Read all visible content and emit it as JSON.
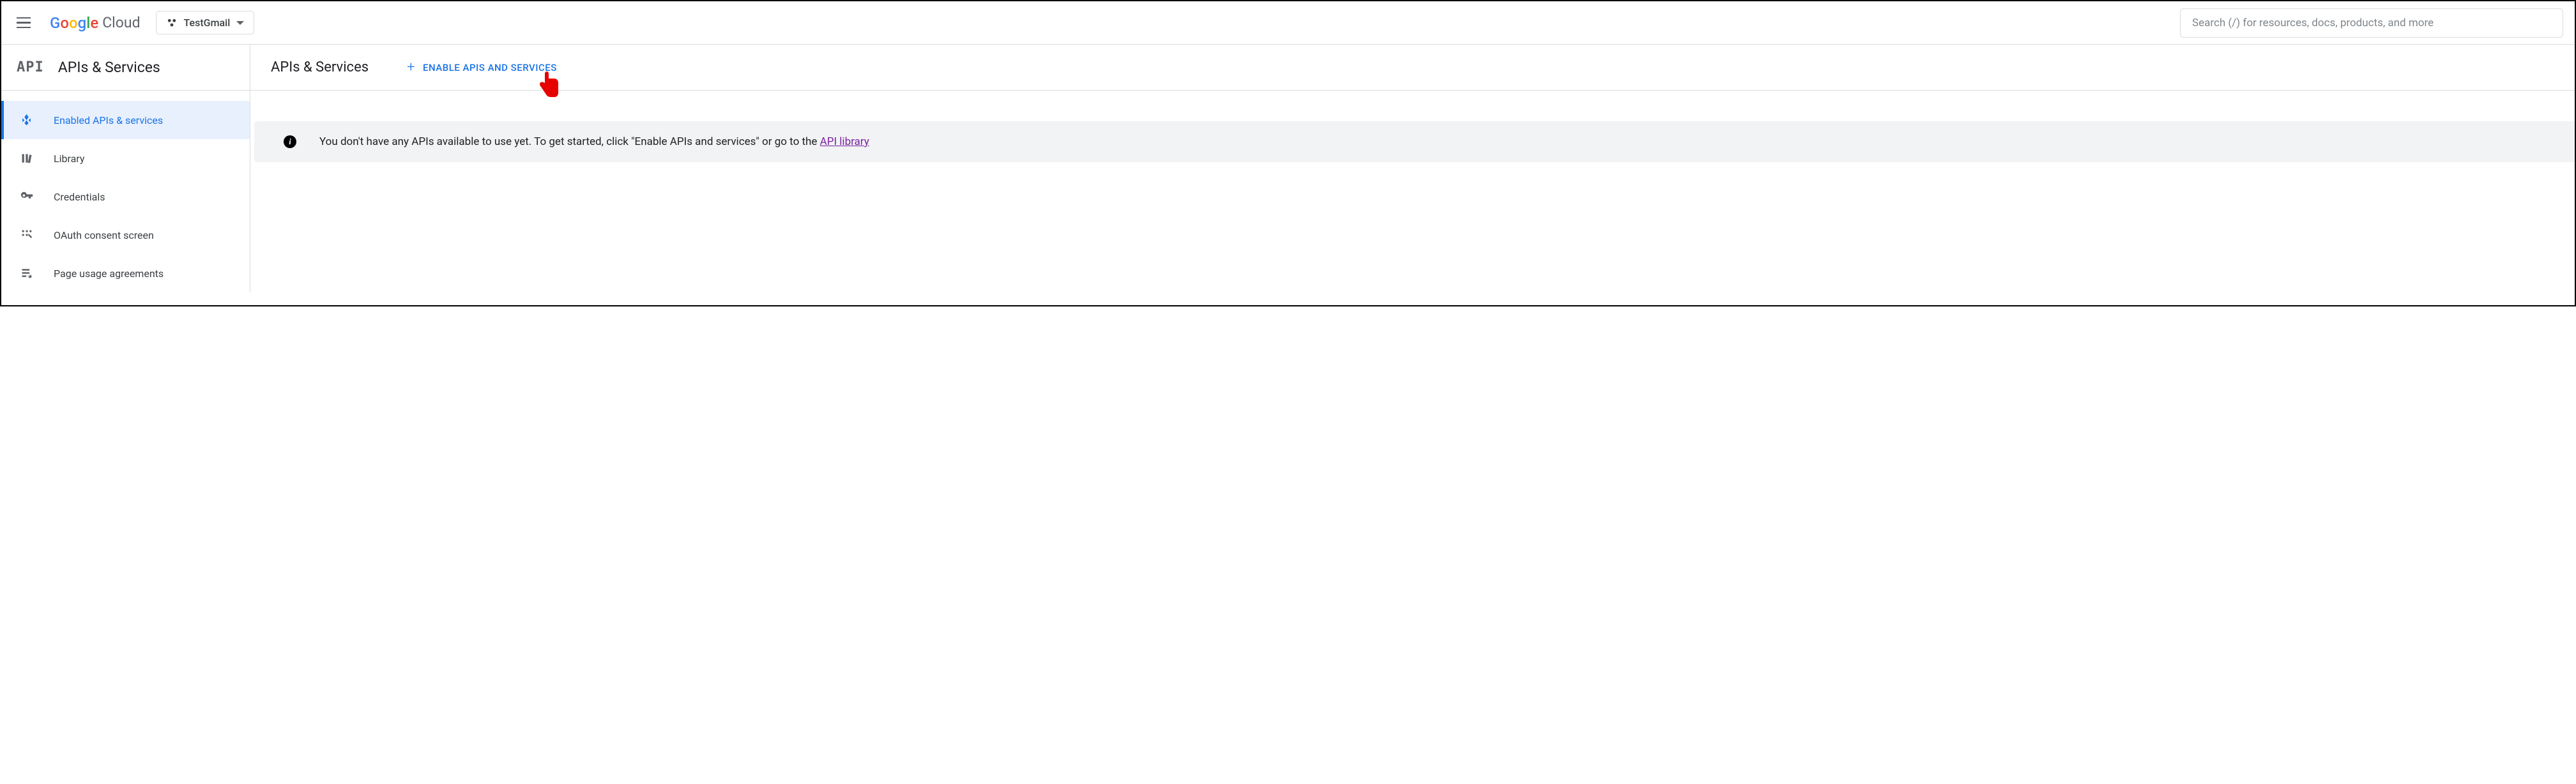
{
  "header": {
    "brand": {
      "google_letters": [
        "G",
        "o",
        "o",
        "g",
        "l",
        "e"
      ],
      "cloud_label": "Cloud"
    },
    "project_name": "TestGmail",
    "search_placeholder": "Search (/) for resources, docs, products, and more"
  },
  "section": {
    "sidebar_title": "APIs & Services",
    "main_title": "APIs & Services",
    "enable_button": "ENABLE APIS AND SERVICES"
  },
  "sidebar": {
    "items": [
      {
        "label": "Enabled APIs & services",
        "icon": "diamond-icon",
        "active": true
      },
      {
        "label": "Library",
        "icon": "library-icon",
        "active": false
      },
      {
        "label": "Credentials",
        "icon": "key-icon",
        "active": false
      },
      {
        "label": "OAuth consent screen",
        "icon": "consent-icon",
        "active": false
      },
      {
        "label": "Page usage agreements",
        "icon": "agreements-icon",
        "active": false
      }
    ]
  },
  "banner": {
    "text": "You don't have any APIs available to use yet. To get started, click \"Enable APIs and services\" or go to the ",
    "link_text": "API library"
  }
}
